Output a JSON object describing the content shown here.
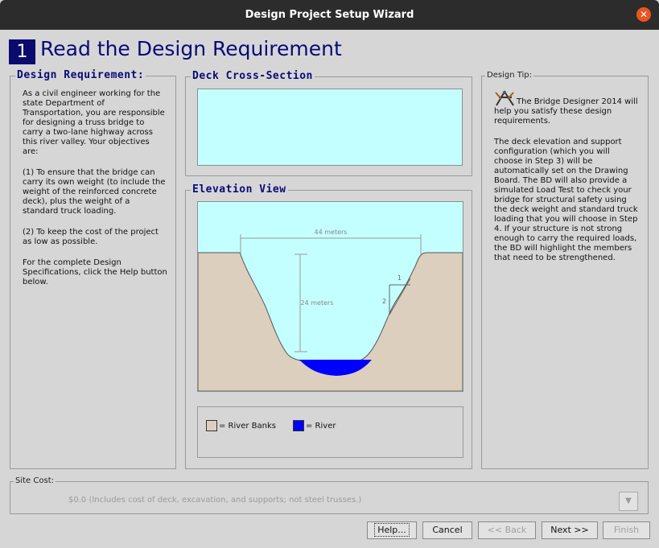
{
  "window": {
    "title": "Design Project Setup Wizard"
  },
  "step": {
    "number": "1",
    "title": "Read the Design Requirement"
  },
  "requirement": {
    "heading": "Design Requirement:",
    "p1": "As a civil engineer working for the state Department of Transportation, you are responsible for designing a truss bridge to carry a two-lane highway across this river valley. Your objectives are:",
    "p2": "(1) To ensure that the bridge can carry its own weight (to include the weight of the reinforced concrete deck), plus the weight of a standard truck loading.",
    "p3": "(2) To keep the cost of the project as low as possible.",
    "p4": "For the complete Design Specifications, click the Help button below."
  },
  "deck": {
    "heading": "Deck Cross-Section"
  },
  "elevation": {
    "heading": "Elevation View",
    "width_label": "44 meters",
    "depth_label": "24 meters",
    "slope_run": "1",
    "slope_rise": "2"
  },
  "legend": {
    "banks": "= River Banks",
    "river": "= River"
  },
  "tip": {
    "heading": "Design Tip:",
    "p1": "The Bridge Designer 2014 will help you satisfy these design requirements.",
    "p2": "The deck elevation and support configuration (which you will choose in Step 3) will be automatically set on the Drawing Board. The BD will also provide a simulated Load Test to check your bridge for structural safety using the deck weight and standard truck loading that you will choose in Step 4. If your structure is not strong enough to carry the required loads, the BD will highlight the members that need to be strengthened."
  },
  "site_cost": {
    "heading": "Site Cost:",
    "text": "$0.0  (Includes cost of deck, excavation, and supports; not steel trusses.)"
  },
  "buttons": {
    "help": "Help...",
    "cancel": "Cancel",
    "back": "<< Back",
    "next": "Next >>",
    "finish": "Finish"
  },
  "colors": {
    "sky": "#c4ffff",
    "bank": "#dccfbe",
    "river": "#0000ff",
    "accent": "#0a0a78"
  },
  "icons": {
    "close": "close-icon",
    "tip": "bridge-designer-icon",
    "dropdown": "chevron-down-icon"
  }
}
